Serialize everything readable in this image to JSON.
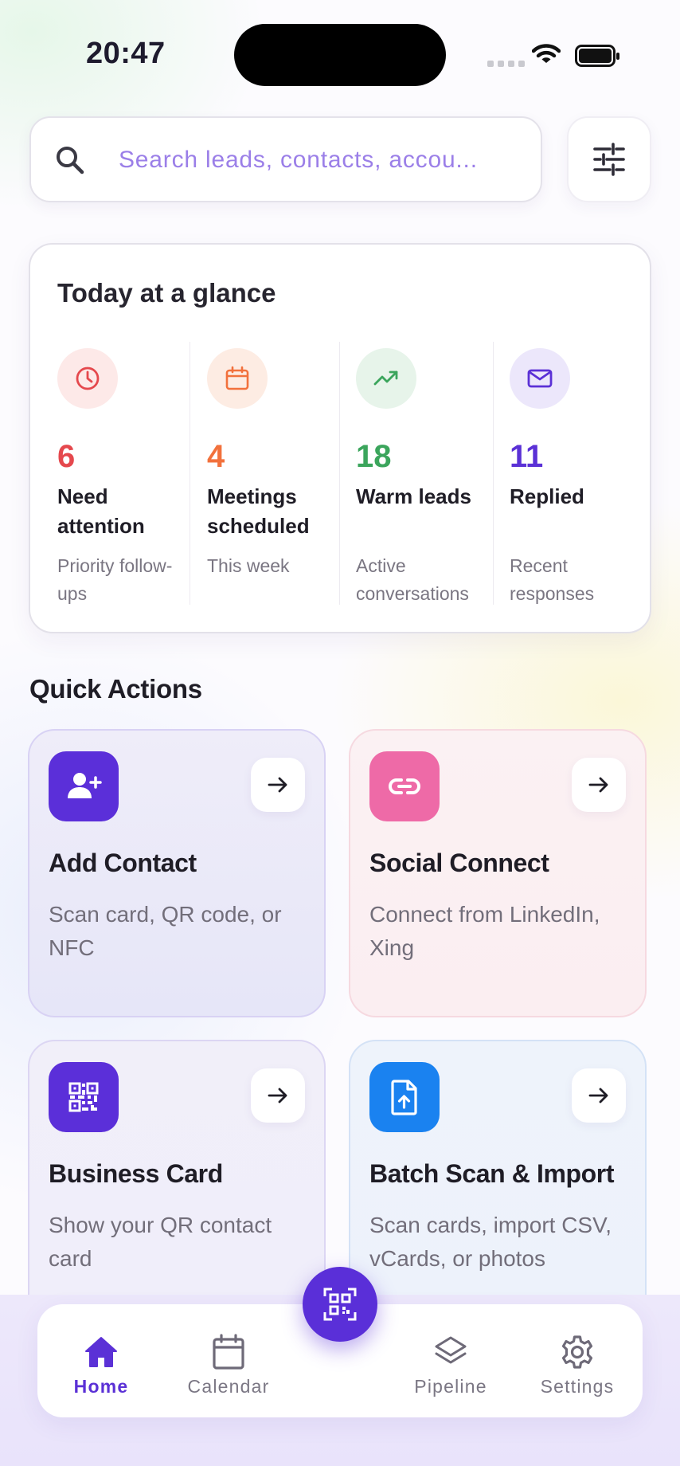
{
  "status_bar": {
    "time": "20:47"
  },
  "search": {
    "placeholder": "Search leads, contacts, accou..."
  },
  "glance": {
    "title": "Today at a glance",
    "stats": [
      {
        "value": "6",
        "label": "Need attention",
        "sub": "Priority follow-ups",
        "icon": "clock-icon",
        "color": "#e5484d",
        "bg": "#fde9e8"
      },
      {
        "value": "4",
        "label": "Meetings scheduled",
        "sub": "This week",
        "icon": "calendar-icon",
        "color": "#f2713c",
        "bg": "#fdece3"
      },
      {
        "value": "18",
        "label": "Warm leads",
        "sub": "Active conversations",
        "icon": "trend-up-icon",
        "color": "#3ba55c",
        "bg": "#e7f4ea"
      },
      {
        "value": "11",
        "label": "Replied",
        "sub": "Recent responses",
        "icon": "mail-icon",
        "color": "#5b31d6",
        "bg": "#ece7fb"
      }
    ]
  },
  "quick_actions": {
    "title": "Quick Actions",
    "cards": [
      {
        "title": "Add Contact",
        "desc": "Scan card, QR code, or NFC",
        "icon": "add-user-icon",
        "icon_bg": "#5b2fd9"
      },
      {
        "title": "Social Connect",
        "desc": "Connect from LinkedIn, Xing",
        "icon": "link-icon",
        "icon_bg": "#ee6aa7"
      },
      {
        "title": "Business Card",
        "desc": "Show your QR contact card",
        "icon": "qr-code-icon",
        "icon_bg": "#5b2fd9"
      },
      {
        "title": "Batch Scan & Import",
        "desc": "Scan cards, import CSV, vCards, or photos",
        "icon": "file-upload-icon",
        "icon_bg": "#1a82f0"
      }
    ]
  },
  "tab_bar": {
    "tabs": [
      {
        "label": "Home",
        "icon": "home-icon",
        "active": true
      },
      {
        "label": "Calendar",
        "icon": "calendar-icon",
        "active": false
      },
      {
        "label": "Pipeline",
        "icon": "layers-icon",
        "active": false
      },
      {
        "label": "Settings",
        "icon": "gear-icon",
        "active": false
      }
    ],
    "fab_icon": "qr-scan-icon"
  },
  "colors": {
    "accent": "#5b31d6",
    "text_primary": "#1f1d26",
    "text_secondary": "#726e7a"
  }
}
